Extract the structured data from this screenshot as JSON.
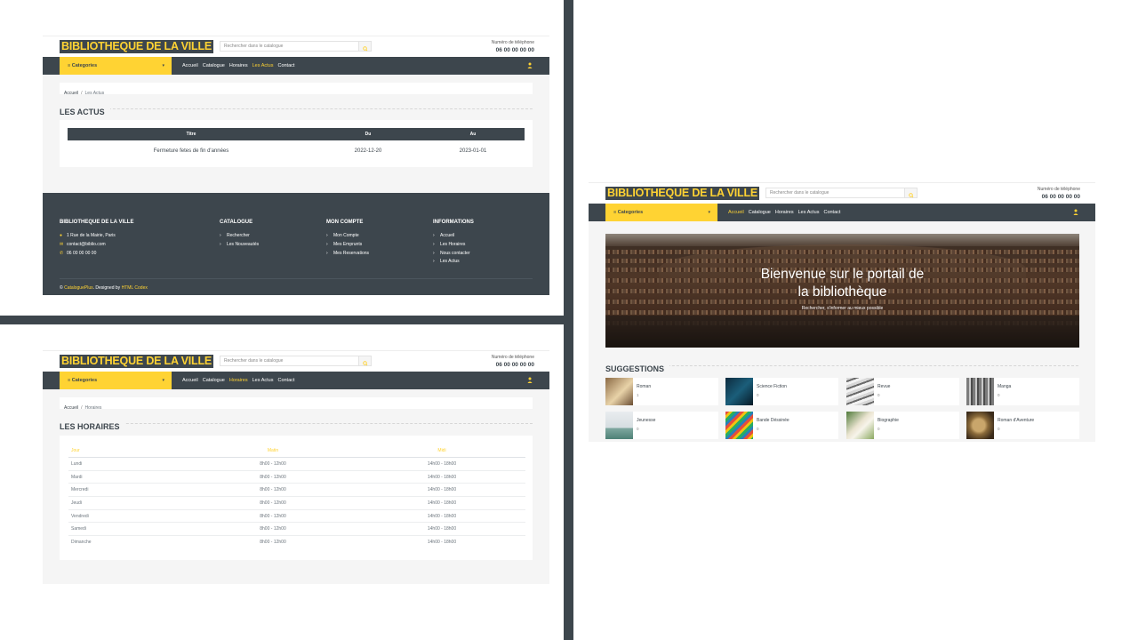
{
  "site": {
    "logo": "BIBLIOTHEQUE DE LA VILLE",
    "search_placeholder": "Rechercher dans le catalogue",
    "phone_label": "Numéro de téléphone",
    "phone_number": "06 00 00 00 00",
    "categories_label": "≡ Categories",
    "menu": [
      "Accueil",
      "Catalogue",
      "Horaires",
      "Les Actus",
      "Contact"
    ]
  },
  "colors": {
    "accent": "#ffd333",
    "dark": "#3d464d",
    "background": "#f5f5f5"
  },
  "actus_page": {
    "breadcrumb": {
      "home": "Accueil",
      "sep": "/",
      "current": "Les Actus"
    },
    "title": "LES ACTUS",
    "table": {
      "headers": [
        "Titre",
        "Du",
        "Au"
      ],
      "rows": [
        {
          "titre": "Fermeture fetes de fin d'années",
          "du": "2022-12-20",
          "au": "2023-01-01"
        }
      ]
    },
    "footer": {
      "col1": {
        "title": "BIBLIOTHEQUE DE LA VILLE",
        "address": "1 Rue de la Mairie, Paris",
        "email": "contact@biblio.com",
        "phone": "06 00 00 00 00"
      },
      "col2": {
        "title": "CATALOGUE",
        "items": [
          "Rechercher",
          "Les Nouveautés"
        ]
      },
      "col3": {
        "title": "MON COMPTE",
        "items": [
          "Mon Compte",
          "Mes Emprunts",
          "Mes Reservations"
        ]
      },
      "col4": {
        "title": "INFORMATIONS",
        "items": [
          "Accueil",
          "Les Horaires",
          "Nous contacter",
          "Les Actus"
        ]
      },
      "copyright_symbol": "©",
      "copyright_brand": "CataloguePlus",
      "copyright_mid": ". Designed by",
      "copyright_designer": "HTML Codex"
    }
  },
  "horaires_page": {
    "breadcrumb": {
      "home": "Accueil",
      "sep": "/",
      "current": "Horaires"
    },
    "title": "LES HORAIRES",
    "headers": [
      "Jour",
      "Matin",
      "Midi"
    ],
    "rows": [
      {
        "jour": "Lundi",
        "matin": "8h00 - 12h00",
        "midi": "14h00 - 18h00"
      },
      {
        "jour": "Mardi",
        "matin": "8h00 - 12h00",
        "midi": "14h00 - 18h00"
      },
      {
        "jour": "Mercredi",
        "matin": "8h00 - 12h00",
        "midi": "14h00 - 18h00"
      },
      {
        "jour": "Jeudi",
        "matin": "8h00 - 12h00",
        "midi": "14h00 - 18h00"
      },
      {
        "jour": "Vendredi",
        "matin": "8h00 - 12h00",
        "midi": "14h00 - 18h00"
      },
      {
        "jour": "Samedi",
        "matin": "8h00 - 12h00",
        "midi": "14h00 - 18h00"
      },
      {
        "jour": "Dimanche",
        "matin": "8h00 - 12h00",
        "midi": "14h00 - 18h00"
      }
    ]
  },
  "home_page": {
    "hero_title_line1": "Bienvenue sur le portail de",
    "hero_title_line2": "la bibliothèque",
    "hero_subtitle": "Rechercher, s'informer au mieux possible",
    "suggestions_title": "SUGGESTIONS",
    "categories": [
      {
        "name": "Roman",
        "count": "1"
      },
      {
        "name": "Science Fiction",
        "count": "0"
      },
      {
        "name": "Revue",
        "count": "0"
      },
      {
        "name": "Manga",
        "count": "0"
      },
      {
        "name": "Jeunesse",
        "count": "0"
      },
      {
        "name": "Bande Déssinée",
        "count": "0"
      },
      {
        "name": "Biographie",
        "count": "0"
      },
      {
        "name": "Roman d'Aventure",
        "count": "0"
      }
    ]
  }
}
